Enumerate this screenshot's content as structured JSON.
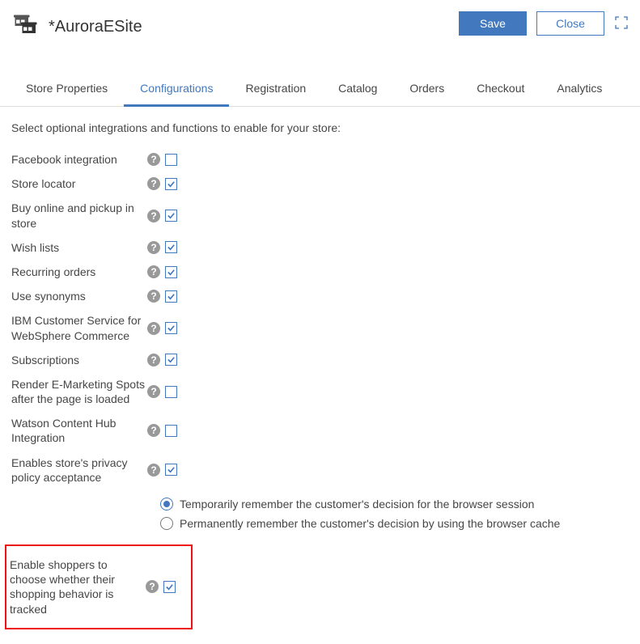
{
  "header": {
    "title": "*AuroraESite",
    "save_label": "Save",
    "close_label": "Close"
  },
  "tabs": [
    {
      "id": "store-properties",
      "label": "Store Properties"
    },
    {
      "id": "configurations",
      "label": "Configurations"
    },
    {
      "id": "registration",
      "label": "Registration"
    },
    {
      "id": "catalog",
      "label": "Catalog"
    },
    {
      "id": "orders",
      "label": "Orders"
    },
    {
      "id": "checkout",
      "label": "Checkout"
    },
    {
      "id": "analytics",
      "label": "Analytics"
    }
  ],
  "active_tab": "configurations",
  "intro": "Select optional integrations and functions to enable for your store:",
  "options": [
    {
      "id": "facebook",
      "label": "Facebook integration",
      "checked": false
    },
    {
      "id": "store-locator",
      "label": "Store locator",
      "checked": true
    },
    {
      "id": "bopis",
      "label": "Buy online and pickup in store",
      "checked": true
    },
    {
      "id": "wish-lists",
      "label": "Wish lists",
      "checked": true
    },
    {
      "id": "recurring",
      "label": "Recurring orders",
      "checked": true
    },
    {
      "id": "synonyms",
      "label": "Use synonyms",
      "checked": true
    },
    {
      "id": "ibm-cs",
      "label": "IBM Customer Service for WebSphere Commerce",
      "checked": true
    },
    {
      "id": "subscriptions",
      "label": "Subscriptions",
      "checked": true
    },
    {
      "id": "render-espots",
      "label": "Render E-Marketing Spots after the page is loaded",
      "checked": false
    },
    {
      "id": "watson-hub",
      "label": "Watson Content Hub Integration",
      "checked": false
    },
    {
      "id": "privacy",
      "label": "Enables store's privacy policy acceptance",
      "checked": true
    }
  ],
  "privacy_radio": {
    "selected": "session",
    "session_label": "Temporarily remember the customer's decision for the browser session",
    "cache_label": "Permanently remember the customer's decision by using the browser cache"
  },
  "tracking_option": {
    "id": "tracking",
    "label": "Enable shoppers to choose whether their shopping behavior is tracked",
    "checked": true
  }
}
